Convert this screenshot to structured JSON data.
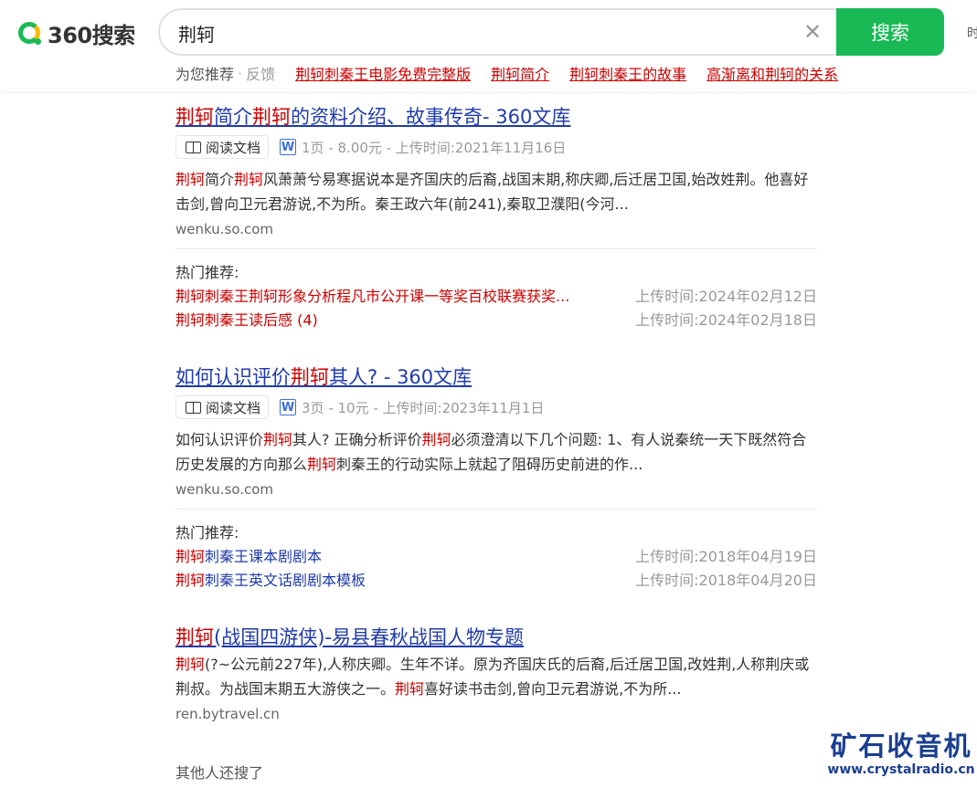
{
  "header": {
    "logo_text": "360搜索",
    "search_value": "荆轲",
    "search_button": "搜索",
    "edge_text": "时"
  },
  "recommend": {
    "label": "为您推荐",
    "feedback": "反馈",
    "links": [
      "荆轲刺秦王电影免费完整版",
      "荆轲简介",
      "荆轲刺秦王的故事",
      "高渐离和荆轲的关系"
    ]
  },
  "results": [
    {
      "title_parts": [
        "荆轲",
        "简介",
        "荆轲",
        "的资料介绍、故事传奇- 360文库"
      ],
      "read_label": "阅读文档",
      "meta": "1页 - 8.00元 - 上传时间:2021年11月16日",
      "desc_parts": [
        "荆轲",
        "简介",
        "荆轲",
        "风萧萧兮易寒据说本是齐国庆的后裔,战国末期,称庆卿,后迁居卫国,始改姓荆。他喜好击剑,曾向卫元君游说,不为所。秦王政六年(前241),秦取卫濮阳(今河..."
      ],
      "url": "wenku.so.com",
      "hot": {
        "label": "热门推荐:",
        "items": [
          {
            "parts": [
              "荆轲",
              "刺秦王",
              "荆轲",
              "形象分析程凡市公开课一等奖百校联赛获奖..."
            ],
            "time": "上传时间:2024年02月12日"
          },
          {
            "parts": [
              "荆轲",
              "刺秦王读后感 (4)"
            ],
            "time": "上传时间:2024年02月18日"
          }
        ]
      }
    },
    {
      "title_parts": [
        "如何认识评价",
        "荆轲",
        "其人? - 360文库"
      ],
      "read_label": "阅读文档",
      "meta": "3页 - 10元 - 上传时间:2023年11月1日",
      "desc_parts": [
        "如何认识评价",
        "荆轲",
        "其人? 正确分析评价",
        "荆轲",
        "必须澄清以下几个问题: 1、有人说秦统一天下既然符合历史发展的方向那么",
        "荆轲",
        "刺秦王的行动实际上就起了阻碍历史前进的作..."
      ],
      "url": "wenku.so.com",
      "hot": {
        "label": "热门推荐:",
        "items": [
          {
            "parts": [
              "荆轲",
              "刺秦王课本剧剧本"
            ],
            "time": "上传时间:2018年04月19日"
          },
          {
            "parts": [
              "荆轲",
              "刺秦王英文话剧剧本模板"
            ],
            "time": "上传时间:2018年04月20日"
          }
        ]
      }
    },
    {
      "title_parts": [
        "荆轲",
        "(战国四游侠)-易县春秋战国人物专题"
      ],
      "desc_parts": [
        "荆轲",
        "(?~公元前227年),人称庆卿。生年不详。原为齐国庆氏的后裔,后迁居卫国,改姓荆,人称荆庆或荆叔。为战国末期五大游侠之一。",
        "荆轲",
        "喜好读书击剑,曾向卫元君游说,不为所..."
      ],
      "url": "ren.bytravel.cn"
    }
  ],
  "others_label": "其他人还搜了",
  "watermark": {
    "main": "矿石收音机",
    "sub": "www.crystalradio.cn"
  },
  "colors": {
    "accent": "#19b955",
    "highlight": "#cc0000",
    "link": "#1f3ba8"
  }
}
